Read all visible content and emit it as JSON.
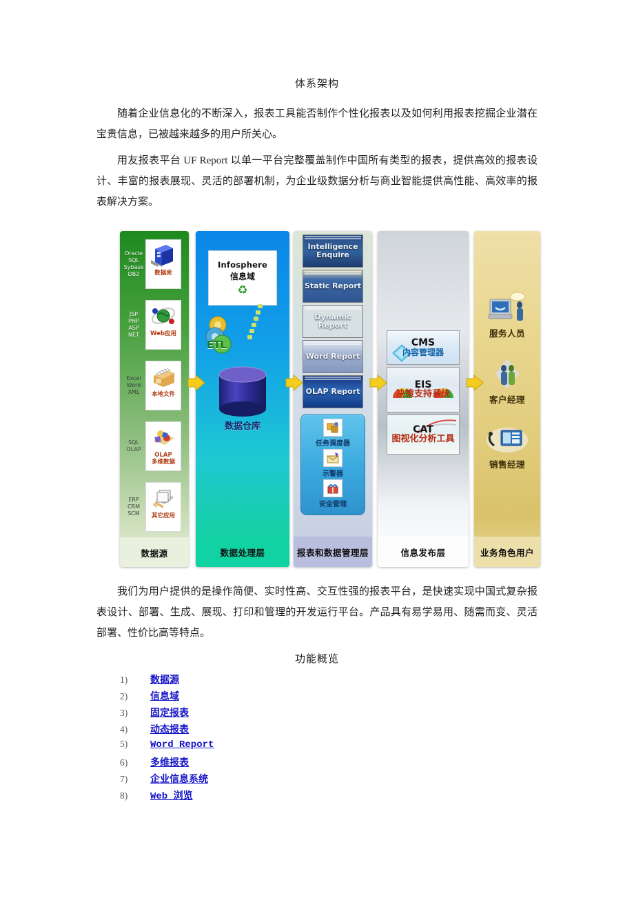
{
  "document": {
    "title": "体系架构",
    "paragraphs": [
      "随着企业信息化的不断深入，报表工具能否制作个性化报表以及如何利用报表挖掘企业潜在宝贵信息，已被越来越多的用户所关心。",
      "用友报表平台 UF Report 以单一平台完整覆盖制作中国所有类型的报表，提供高效的报表设计、丰富的报表展现、灵活的部署机制，为企业级数据分析与商业智能提供高性能、高效率的报表解决方案。",
      "我们为用户提供的是操作简便、实时性高、交互性强的报表平台，是快速实现中国式复杂报表设计、部署、生成、展现、打印和管理的开发运行平台。产品具有易学易用、随需而变、灵活部署、性价比高等特点。"
    ],
    "section_title": "功能概览"
  },
  "diagram": {
    "columns": [
      {
        "id": "data-source",
        "footer": "数据源",
        "color": "#3f9a37",
        "items": [
          {
            "tags": "Oracle\nSQL\nSybase\nDB2",
            "caption": "数据库",
            "icon": "database-server-icon"
          },
          {
            "tags": "JSP\nPHP\nASP\nNET",
            "caption": "Web应用",
            "icon": "web-globe-icon"
          },
          {
            "tags": "Excel\nWord\nXML",
            "caption": "本地文件",
            "icon": "file-box-icon"
          },
          {
            "tags": "SQL\nOLAP",
            "caption": "OLAP\n多维数据",
            "icon": "olap-cube-icon"
          },
          {
            "tags": "ERP\nCRM\nSCM",
            "caption": "其它应用",
            "icon": "applications-icon"
          }
        ]
      },
      {
        "id": "data-processing",
        "footer": "数据处理层",
        "color": "#12a0e8",
        "infosphere_title": "Infosphere",
        "infosphere_subtitle": "信息域",
        "infosphere_icon": "recycle-icon",
        "etl_label": "ETL",
        "warehouse_label": "数据仓库",
        "warehouse_icon": "database-cylinder-icon"
      },
      {
        "id": "report-data-management",
        "footer": "报表和数据管理层",
        "color": "#b9bdde",
        "reports": [
          "Intelligence Enquire",
          "Static Report",
          "Dynamic Report",
          "Word Report",
          "OLAP Report"
        ],
        "management": [
          {
            "caption": "任务调度器",
            "icon": "scheduler-icon"
          },
          {
            "caption": "示警器",
            "icon": "alert-mail-icon"
          },
          {
            "caption": "安全管理",
            "icon": "security-lock-icon"
          }
        ]
      },
      {
        "id": "information-publishing",
        "footer": "信息发布层",
        "color": "#e6e9ec",
        "items": [
          {
            "abbr": "CMS",
            "name": "内容管理器",
            "icon": "cms-diamond-icon"
          },
          {
            "abbr": "EIS",
            "name": "决策支持系统",
            "icon": "eis-gauge-icon"
          },
          {
            "abbr": "CAT",
            "name": "图视化分析工具",
            "icon": "cat-chart-icon"
          }
        ]
      },
      {
        "id": "business-role-users",
        "footer": "业务角色用户",
        "color": "#e2cd7e",
        "roles": [
          {
            "caption": "服务人员",
            "icon": "service-staff-icon"
          },
          {
            "caption": "客户经理",
            "icon": "account-manager-icon"
          },
          {
            "caption": "销售经理",
            "icon": "sales-manager-icon"
          }
        ]
      }
    ],
    "arrow_icon": "right-arrow-icon",
    "arrow_color": "#f2c413"
  },
  "features": [
    {
      "num": "1)",
      "label": "数据源",
      "mono": false
    },
    {
      "num": "2)",
      "label": "信息域",
      "mono": false
    },
    {
      "num": "3)",
      "label": "固定报表",
      "mono": false
    },
    {
      "num": "4)",
      "label": "动态报表",
      "mono": false
    },
    {
      "num": "5)",
      "label": "Word Report",
      "mono": true
    },
    {
      "num": "6)",
      "label": "多维报表",
      "mono": false
    },
    {
      "num": "7)",
      "label": "企业信息系统",
      "mono": false
    },
    {
      "num": "8)",
      "label": "Web 浏览",
      "mono": true
    }
  ]
}
